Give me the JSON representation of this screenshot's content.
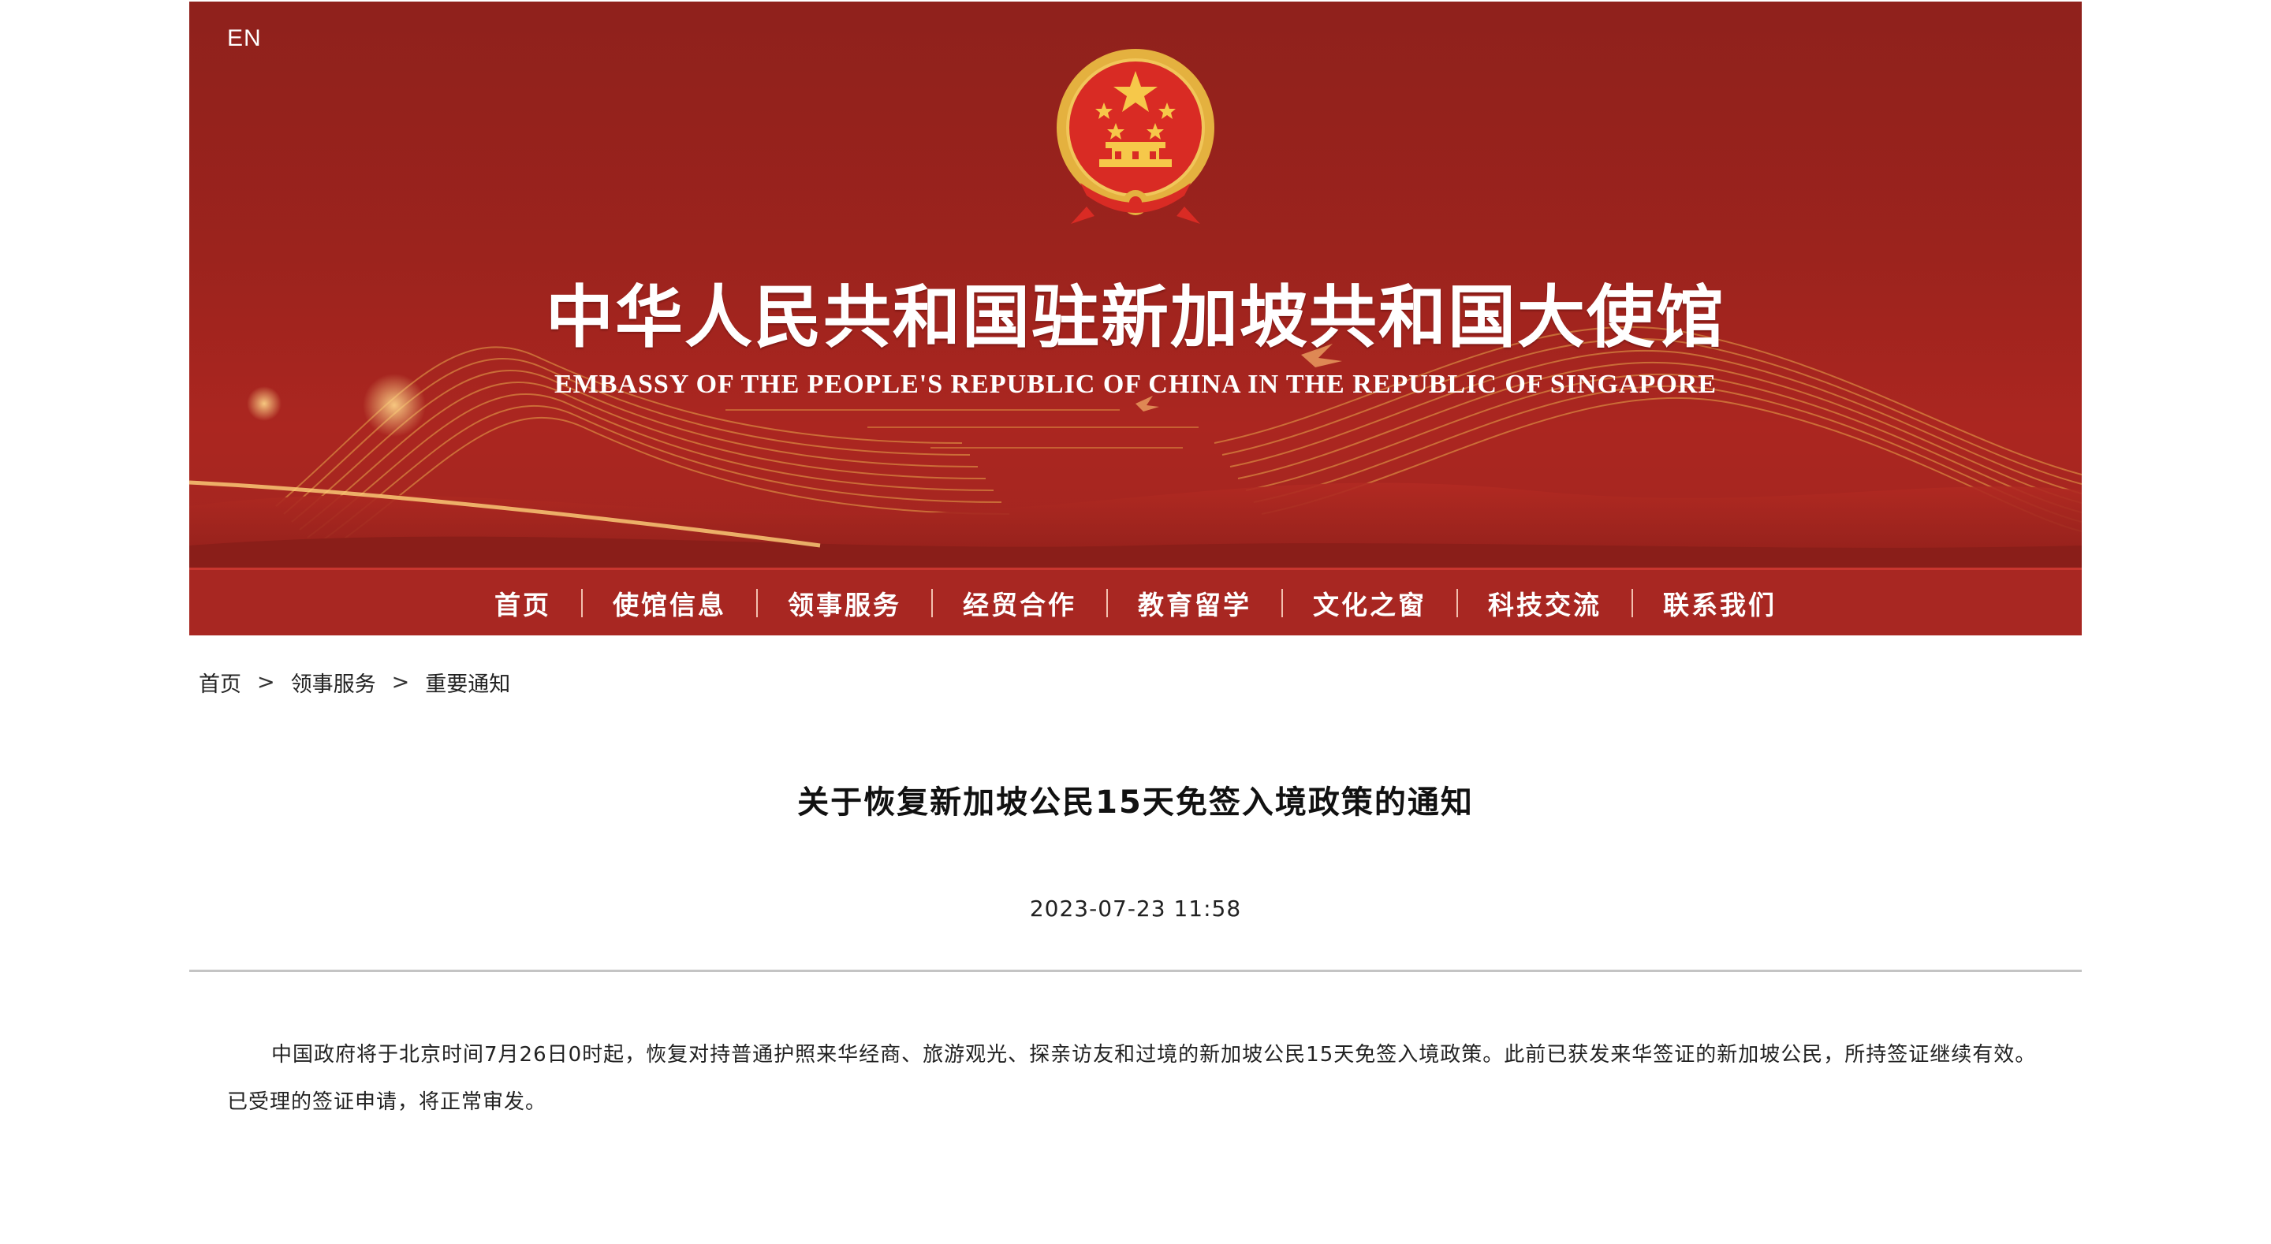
{
  "header": {
    "lang_switch": "EN",
    "title_cn": "中华人民共和国驻新加坡共和国大使馆",
    "title_en": "EMBASSY OF THE PEOPLE'S REPUBLIC OF CHINA IN THE REPUBLIC OF SINGAPORE"
  },
  "nav": {
    "items": [
      {
        "label": "首页"
      },
      {
        "label": "使馆信息"
      },
      {
        "label": "领事服务"
      },
      {
        "label": "经贸合作"
      },
      {
        "label": "教育留学"
      },
      {
        "label": "文化之窗"
      },
      {
        "label": "科技交流"
      },
      {
        "label": "联系我们"
      }
    ]
  },
  "breadcrumb": {
    "items": [
      "首页",
      "领事服务",
      "重要通知"
    ],
    "separator": ">"
  },
  "article": {
    "title": "关于恢复新加坡公民15天免签入境政策的通知",
    "date": "2023-07-23 11:58",
    "body": "中国政府将于北京时间7月26日0时起，恢复对持普通护照来华经商、旅游观光、探亲访友和过境的新加坡公民15天免签入境政策。此前已获发来华签证的新加坡公民，所持签证继续有效。已受理的签证申请，将正常审发。"
  },
  "colors": {
    "banner_red": "#9c231d",
    "nav_red": "#a82722",
    "gold": "#e6b34a"
  }
}
